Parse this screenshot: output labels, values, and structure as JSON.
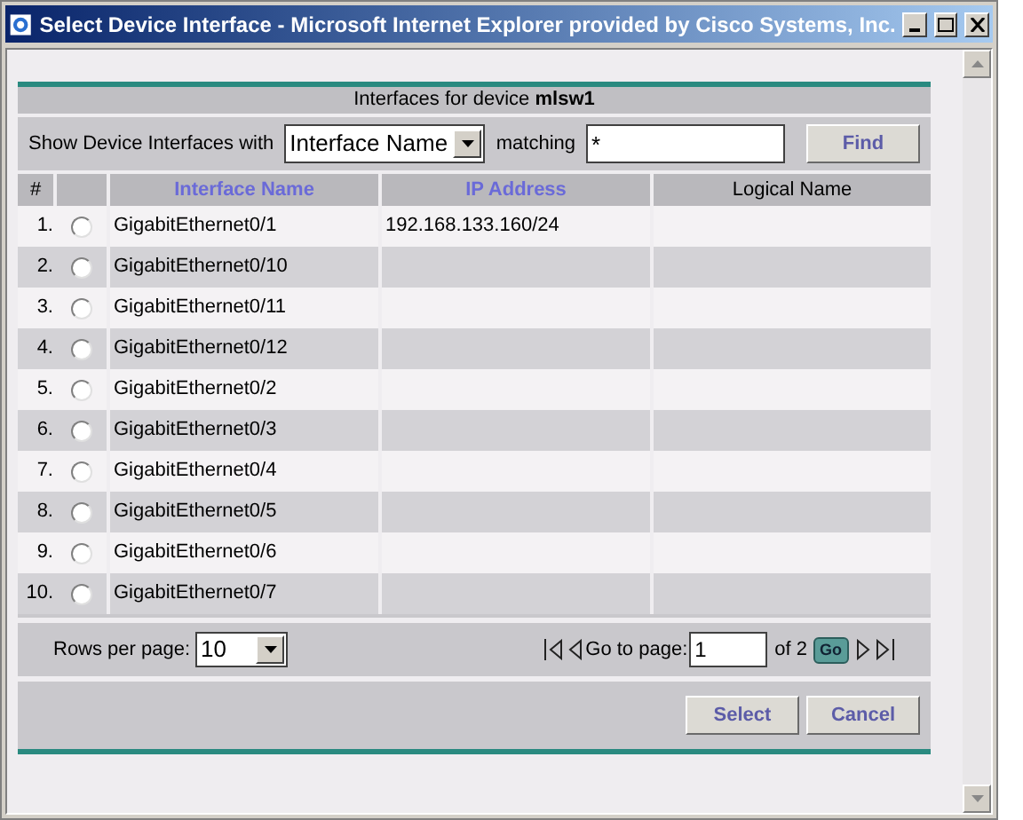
{
  "window": {
    "title": "Select Device Interface - Microsoft Internet Explorer provided by Cisco Systems, Inc."
  },
  "heading": {
    "text": "Interfaces for device ",
    "device": "mlsw1"
  },
  "filter": {
    "label": "Show Device Interfaces with",
    "field": "Interface Name",
    "matching_label": "matching",
    "value": "*",
    "button": "Find"
  },
  "table": {
    "columns": [
      {
        "label": "#",
        "link": false
      },
      {
        "label": "Interface Name",
        "link": true
      },
      {
        "label": "IP Address",
        "link": true
      },
      {
        "label": "Logical Name",
        "link": false
      }
    ],
    "rows": [
      {
        "index": "1.",
        "selected": false,
        "name": "GigabitEthernet0/1",
        "ip": "192.168.133.160/24"
      },
      {
        "index": "2.",
        "selected": false,
        "name": "GigabitEthernet0/10"
      },
      {
        "index": "3.",
        "selected": false,
        "name": "GigabitEthernet0/11"
      },
      {
        "index": "4.",
        "selected": false,
        "name": "GigabitEthernet0/12"
      },
      {
        "index": "5.",
        "selected": false,
        "name": "GigabitEthernet0/2"
      },
      {
        "index": "6.",
        "selected": false,
        "name": "GigabitEthernet0/3"
      },
      {
        "index": "7.",
        "selected": false,
        "name": "GigabitEthernet0/4"
      },
      {
        "index": "8.",
        "selected": false,
        "name": "GigabitEthernet0/5"
      },
      {
        "index": "9.",
        "selected": false,
        "name": "GigabitEthernet0/6"
      },
      {
        "index": "10.",
        "selected": false,
        "name": "GigabitEthernet0/7"
      }
    ]
  },
  "pagination": {
    "rows_label": "Rows per page:",
    "rows_value": "10",
    "goto_label": "Go to page:",
    "page": "1",
    "of": "of 2",
    "go": "Go"
  },
  "buttons": [
    "Select",
    "Cancel"
  ]
}
